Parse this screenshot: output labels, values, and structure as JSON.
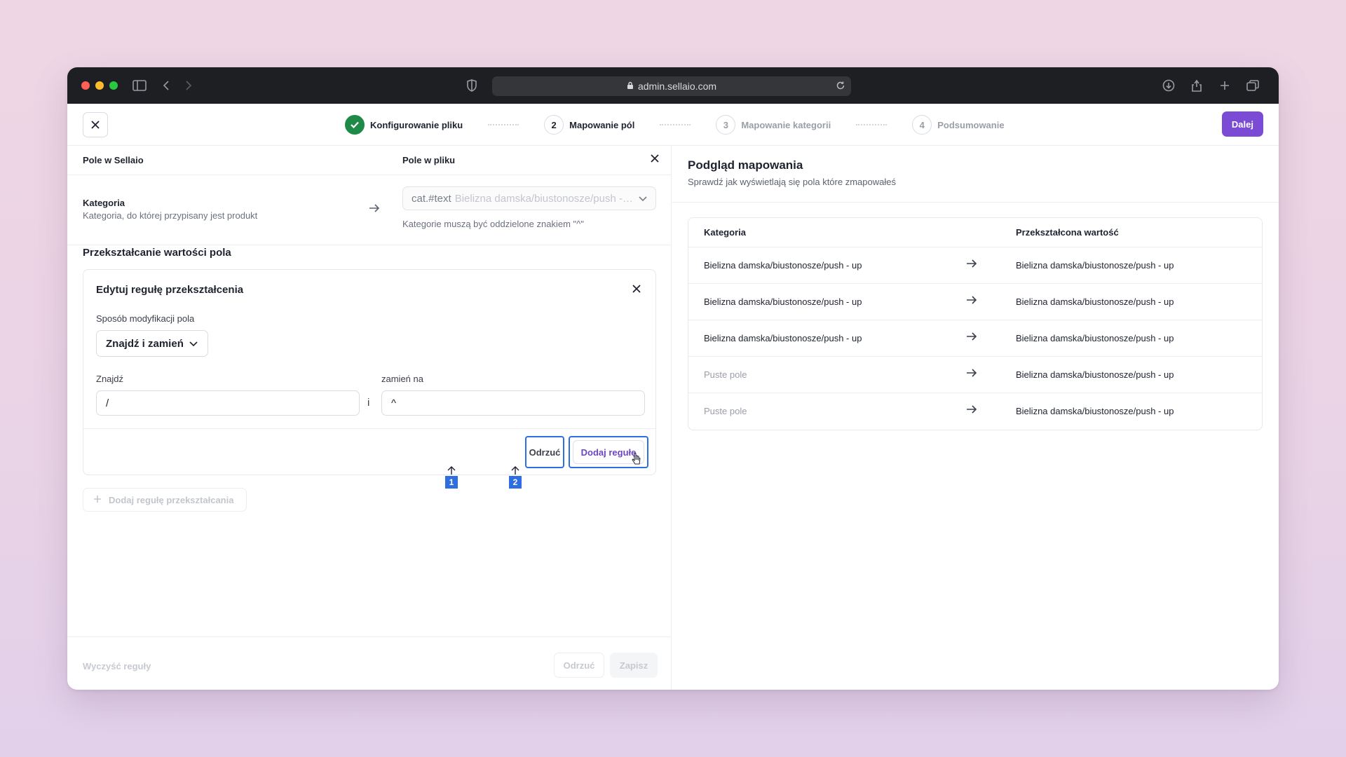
{
  "browser": {
    "url": "admin.sellaio.com",
    "traffic_colors": [
      "#ff5f57",
      "#febc2e",
      "#28c840"
    ]
  },
  "header": {
    "steps": [
      {
        "number": "",
        "label": "Konfigurowanie pliku",
        "state": "done"
      },
      {
        "number": "2",
        "label": "Mapowanie pól",
        "state": "active"
      },
      {
        "number": "3",
        "label": "Mapowanie kategorii",
        "state": "inactive"
      },
      {
        "number": "4",
        "label": "Podsumowanie",
        "state": "inactive"
      }
    ],
    "next_label": "Dalej",
    "accent": "#7b4bd6"
  },
  "left": {
    "col_sellaio": "Pole w Sellaio",
    "col_file": "Pole w pliku",
    "field_title": "Kategoria",
    "field_desc": "Kategoria, do której przypisany jest produkt",
    "file_key": "cat.#text",
    "file_value": "Bielizna damska/biustonosze/push - up",
    "file_hint": "Kategorie muszą być oddzielone znakiem \"^\"",
    "section_title": "Przekształcanie wartości pola",
    "rule": {
      "title": "Edytuj regułę przekształcenia",
      "mode_label": "Sposób modyfikacji pola",
      "mode_value": "Znajdź i zamień",
      "find_label": "Znajdź",
      "replace_label": "zamień na",
      "find_value": "/",
      "replace_value": "^",
      "and_text": "i",
      "reject_label": "Odrzuć",
      "add_label": "Dodaj regułę"
    },
    "markers": [
      "1",
      "2"
    ],
    "add_rule_label": "Dodaj regułę przekształcania",
    "footer": {
      "clear_label": "Wyczyść reguły",
      "reject_label": "Odrzuć",
      "save_label": "Zapisz"
    }
  },
  "right": {
    "title": "Podgląd mapowania",
    "subtitle": "Sprawdź jak wyświetlają się pola które zmapowałeś",
    "col_source": "Kategoria",
    "col_result": "Przekształcona wartość",
    "rows": [
      {
        "source": "Bielizna damska/biustonosze/push - up",
        "result": "Bielizna damska/biustonosze/push - up",
        "empty": false
      },
      {
        "source": "Bielizna damska/biustonosze/push - up",
        "result": "Bielizna damska/biustonosze/push - up",
        "empty": false
      },
      {
        "source": "Bielizna damska/biustonosze/push - up",
        "result": "Bielizna damska/biustonosze/push - up",
        "empty": false
      },
      {
        "source": "Puste pole",
        "result": "Bielizna damska/biustonosze/push - up",
        "empty": true
      },
      {
        "source": "Puste pole",
        "result": "Bielizna damska/biustonosze/push - up",
        "empty": true
      }
    ]
  }
}
